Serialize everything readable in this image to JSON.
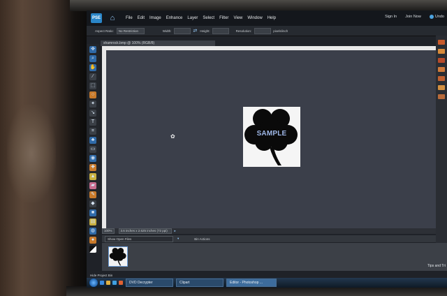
{
  "menubar": {
    "logo_text": "PSE",
    "items": [
      "File",
      "Edit",
      "Image",
      "Enhance",
      "Layer",
      "Select",
      "Filter",
      "View",
      "Window",
      "Help"
    ],
    "sign_in": "Sign In",
    "join_now": "Join Now",
    "undo": "Undo"
  },
  "options_bar": {
    "aspect_ratio_label": "Aspect Ratio:",
    "aspect_ratio_value": "No Restriction",
    "width_label": "Width:",
    "height_label": "Height:",
    "resolution_label": "Resolution:",
    "resolution_unit": "pixels/inch"
  },
  "document": {
    "tab_title": "shamrock.bmp @ 100% (RGB/8)",
    "image_text": "SAMPLE"
  },
  "statusbar": {
    "zoom": "100%",
    "doc_size": "3.6 inches x 2.625 inches (72 ppi)"
  },
  "project_bin": {
    "show_label": "Show Open Files",
    "bin_actions": "Bin Actions",
    "hide_label": "Hide Project Bin",
    "tips": "Tips and Tri"
  },
  "taskbar": {
    "items": [
      "DVD Decrypter",
      "Clipart",
      "Editor - Photoshop ..."
    ]
  },
  "colors": {
    "canvas_bg": "#3b3f4a",
    "menubar_bg": "#14171c",
    "accent": "#2a86c8"
  }
}
